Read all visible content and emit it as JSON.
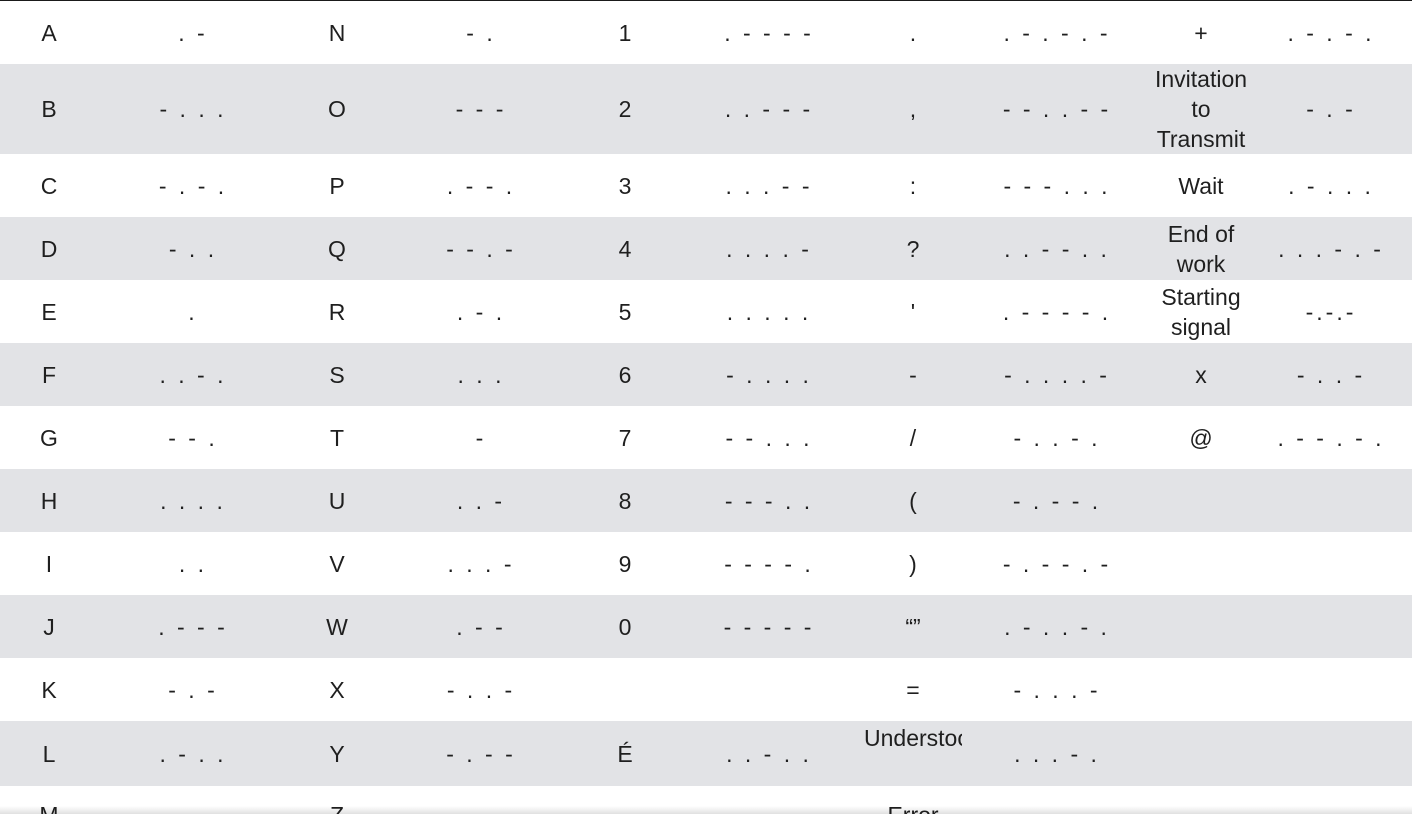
{
  "rows": [
    [
      {
        "symbol": "A",
        "code": ". -"
      },
      {
        "symbol": "N",
        "code": "- ."
      },
      {
        "symbol": "1",
        "code": ". - - - -"
      },
      {
        "symbol": ".",
        "code": ". - . - . -"
      },
      {
        "symbol": "+",
        "code": ". - . - ."
      }
    ],
    [
      {
        "symbol": "B",
        "code": "- . . ."
      },
      {
        "symbol": "O",
        "code": "- - -"
      },
      {
        "symbol": "2",
        "code": ". . - - -"
      },
      {
        "symbol": ",",
        "code": "- - . . - -"
      },
      {
        "symbol": "Invitation to\nTransmit",
        "code": "- . -"
      }
    ],
    [
      {
        "symbol": "C",
        "code": "- . - ."
      },
      {
        "symbol": "P",
        "code": ". - - ."
      },
      {
        "symbol": "3",
        "code": ". . . - -"
      },
      {
        "symbol": ":",
        "code": "- - - . . ."
      },
      {
        "symbol": "Wait",
        "code": ". - . . ."
      }
    ],
    [
      {
        "symbol": "D",
        "code": "- . ."
      },
      {
        "symbol": "Q",
        "code": "- - . -"
      },
      {
        "symbol": "4",
        "code": ". . . . -"
      },
      {
        "symbol": "?",
        "code": ". . - - . ."
      },
      {
        "symbol": "End of\nwork",
        "code": ". . . - . -"
      }
    ],
    [
      {
        "symbol": "E",
        "code": "."
      },
      {
        "symbol": "R",
        "code": ". - ."
      },
      {
        "symbol": "5",
        "code": ". . . . ."
      },
      {
        "symbol": "'",
        "code": ". - - - - ."
      },
      {
        "symbol": "Starting\nsignal",
        "code": "-.-.-"
      }
    ],
    [
      {
        "symbol": "F",
        "code": ". . - ."
      },
      {
        "symbol": "S",
        "code": ". . ."
      },
      {
        "symbol": "6",
        "code": "- . . . ."
      },
      {
        "symbol": "-",
        "code": "- . . . . -"
      },
      {
        "symbol": "x",
        "code": "- . . -"
      }
    ],
    [
      {
        "symbol": "G",
        "code": "- - ."
      },
      {
        "symbol": "T",
        "code": "-"
      },
      {
        "symbol": "7",
        "code": "- - . . ."
      },
      {
        "symbol": "/",
        "code": "- . . - ."
      },
      {
        "symbol": "@",
        "code": ". - - . - ."
      }
    ],
    [
      {
        "symbol": "H",
        "code": ". . . ."
      },
      {
        "symbol": "U",
        "code": ". . -"
      },
      {
        "symbol": "8",
        "code": "- - - . ."
      },
      {
        "symbol": "(",
        "code": "- . - - ."
      },
      {
        "symbol": "",
        "code": ""
      }
    ],
    [
      {
        "symbol": "I",
        "code": ". ."
      },
      {
        "symbol": "V",
        "code": ". . . -"
      },
      {
        "symbol": "9",
        "code": "- - - - ."
      },
      {
        "symbol": ")",
        "code": "- . - - . -"
      },
      {
        "symbol": "",
        "code": ""
      }
    ],
    [
      {
        "symbol": "J",
        "code": ". - - -"
      },
      {
        "symbol": "W",
        "code": ". - -"
      },
      {
        "symbol": "0",
        "code": "- - - - -"
      },
      {
        "symbol": "“”",
        "code": ". - . . - ."
      },
      {
        "symbol": "",
        "code": ""
      }
    ],
    [
      {
        "symbol": "K",
        "code": "- . -"
      },
      {
        "symbol": "X",
        "code": "- . . -"
      },
      {
        "symbol": "",
        "code": ""
      },
      {
        "symbol": "=",
        "code": "- . . . -"
      },
      {
        "symbol": "",
        "code": ""
      }
    ],
    [
      {
        "symbol": "L",
        "code": ". - . ."
      },
      {
        "symbol": "Y",
        "code": "- . - -"
      },
      {
        "symbol": "É",
        "code": ". . - . ."
      },
      {
        "symbol": "Understood",
        "code": ". . . - ."
      },
      {
        "symbol": "",
        "code": ""
      }
    ],
    [
      {
        "symbol": "M",
        "code": "- -"
      },
      {
        "symbol": "Z",
        "code": "- - . ."
      },
      {
        "symbol": "",
        "code": ""
      },
      {
        "symbol": "Error",
        "code": ". . . . . . . ."
      },
      {
        "symbol": "",
        "code": ""
      }
    ]
  ]
}
